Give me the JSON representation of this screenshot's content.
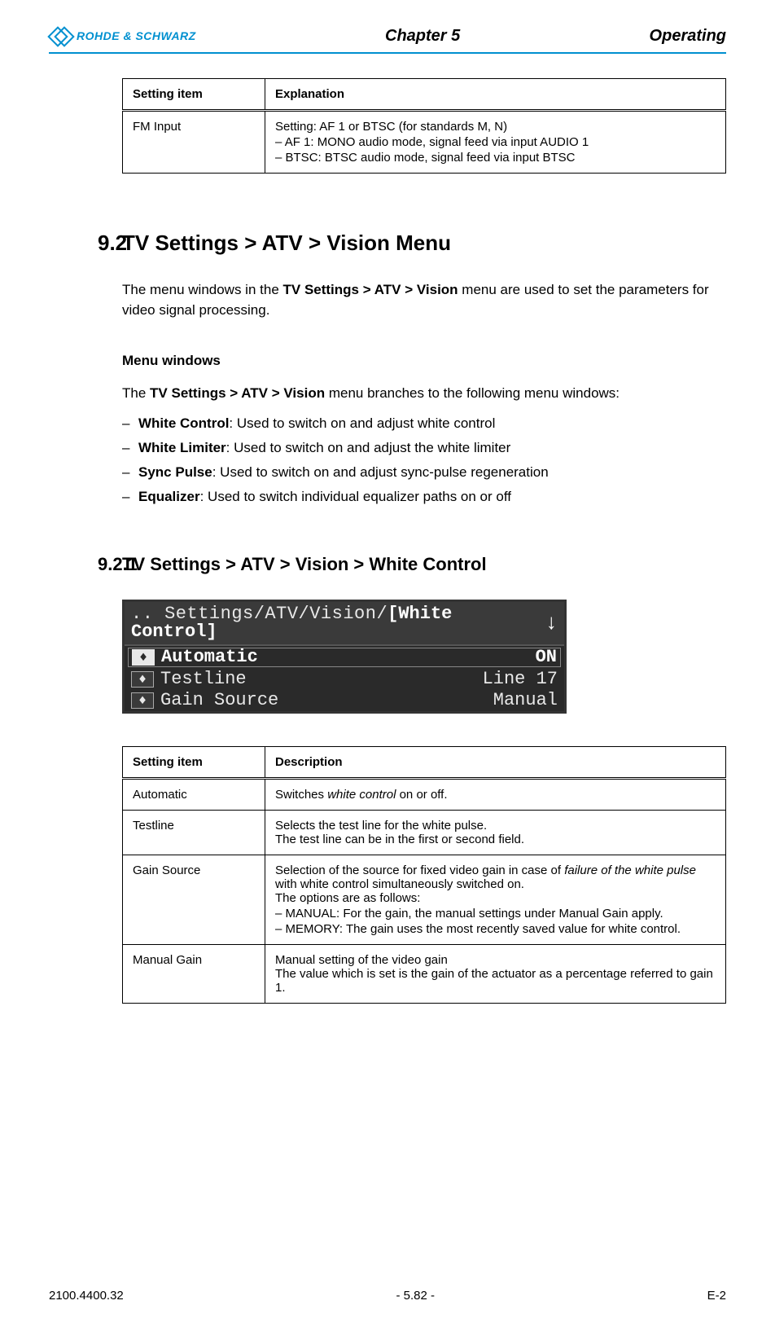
{
  "header": {
    "brand": "ROHDE & SCHWARZ",
    "chapter": "Chapter 5",
    "section_name": "Operating"
  },
  "table1": {
    "headers": [
      "Setting item",
      "Explanation"
    ],
    "row": {
      "item": "FM Input",
      "line1": "Setting: AF 1 or BTSC (for standards M, N)",
      "b1": "AF 1: MONO audio mode, signal feed via input AUDIO 1",
      "b2": "BTSC: BTSC audio mode, signal feed via input BTSC"
    }
  },
  "sec92": {
    "num": "9.2",
    "title": "TV Settings > ATV > Vision Menu",
    "para_pre": "The menu windows in the ",
    "para_bold": "TV Settings > ATV > Vision",
    "para_post": " menu are used to set the parameters for video signal processing.",
    "mw_heading": "Menu windows",
    "mw_line_pre": "The ",
    "mw_line_bold": "TV Settings > ATV > Vision",
    "mw_line_post": " menu branches to the following menu windows:",
    "bullets": [
      {
        "b": "White Control",
        "t": ": Used to switch on and adjust white control"
      },
      {
        "b": "White Limiter",
        "t": ": Used to switch on and adjust the white limiter"
      },
      {
        "b": "Sync Pulse",
        "t": ": Used to switch on and adjust sync-pulse regeneration"
      },
      {
        "b": "Equalizer",
        "t": ": Used to switch individual equalizer paths on or off"
      }
    ]
  },
  "sec921": {
    "num": "9.2.1",
    "title": "TV Settings > ATV > Vision > White Control"
  },
  "lcd": {
    "crumb_prefix": ".. Settings/ATV/Vision/",
    "crumb_active_open": "[",
    "crumb_active": "White Control",
    "crumb_active_close": "]",
    "arrow": "↓",
    "rows": [
      {
        "label": "Automatic",
        "value": "ON",
        "selected": true
      },
      {
        "label": "Testline",
        "value": "Line 17",
        "selected": false
      },
      {
        "label": "Gain Source",
        "value": "Manual",
        "selected": false
      }
    ]
  },
  "table2": {
    "headers": [
      "Setting item",
      "Description"
    ],
    "rows": {
      "r0": {
        "item": "Automatic",
        "p1a": "Switches ",
        "p1i": "white control",
        "p1b": " on or off."
      },
      "r1": {
        "item": "Testline",
        "l1": "Selects the test line for the white pulse.",
        "l2": "The test line can be in the first or second field."
      },
      "r2": {
        "item": "Gain Source",
        "l1a": "Selection of the source for fixed video gain in case of ",
        "l1i": "failure of the white pulse",
        "l1b": " with white control simultaneously switched on.",
        "l2": "The options are as follows:",
        "b1": "MANUAL: For the gain, the manual settings under Manual Gain apply.",
        "b2": "MEMORY: The gain uses the most recently saved value for white control."
      },
      "r3": {
        "item": "Manual Gain",
        "l1": "Manual setting of the video gain",
        "l2": "The value which is set is the gain of the actuator as a percentage referred to gain 1."
      }
    }
  },
  "footer": {
    "left": "2100.4400.32",
    "center": "- 5.82 -",
    "right": "E-2"
  }
}
